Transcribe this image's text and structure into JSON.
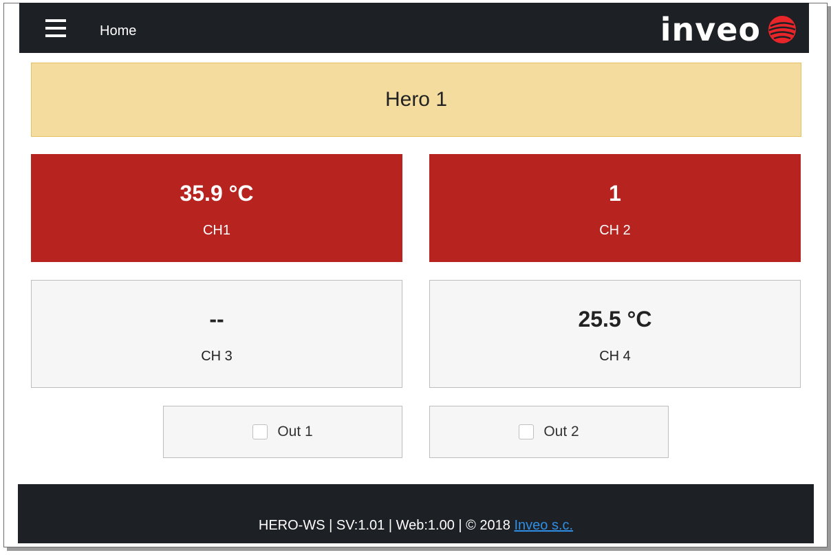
{
  "nav": {
    "menu_icon": "hamburger-menu-icon",
    "home_label": "Home"
  },
  "logo": {
    "text": "inveo",
    "icon": "striped-red-ball-icon",
    "accent": "#e8262a"
  },
  "banner": {
    "title": "Hero 1",
    "color": "#f3dc9e"
  },
  "channels": [
    {
      "value": "35.9 °C",
      "label": "CH1",
      "state": "alarm",
      "color": "#b7241f"
    },
    {
      "value": "1",
      "label": "CH 2",
      "state": "alarm",
      "color": "#b7241f"
    },
    {
      "value": "--",
      "label": "CH 3",
      "state": "normal",
      "color": "#f6f6f6"
    },
    {
      "value": "25.5 °C",
      "label": "CH 4",
      "state": "normal",
      "color": "#f6f6f6"
    }
  ],
  "outputs": [
    {
      "label": "Out 1",
      "checked": false
    },
    {
      "label": "Out 2",
      "checked": false
    }
  ],
  "footer": {
    "text": "HERO-WS | SV:1.01 | Web:1.00 | © 2018 ",
    "link": "Inveo s.c."
  }
}
